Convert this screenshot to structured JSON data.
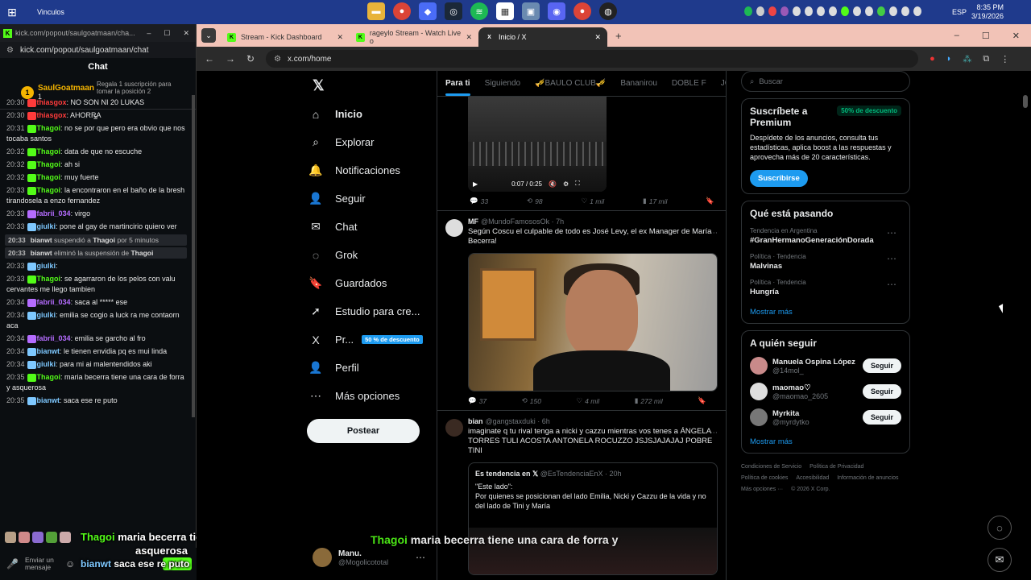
{
  "taskbar": {
    "title": "Vinculos",
    "lang": "ESP",
    "time": "8:35 PM",
    "date": "3/19/2026"
  },
  "popout": {
    "tab_title": "kick.com/popout/saulgoatmaan/cha...",
    "url": "kick.com/popout/saulgoatmaan/chat",
    "header": "Chat",
    "pinned_user": "SaulGoatmaan",
    "pinned_count": "1",
    "pinned_gift": "Regala 1 suscripción para tomar la posición 2",
    "input_placeholder": "Enviar un mensaje",
    "chat_button": "Chat"
  },
  "messages": [
    {
      "time": "20:30",
      "user": "thiasgox",
      "color": "#ff3b3b",
      "text": ": NO SON NI 20 LUKAS"
    },
    {
      "time": "20:30",
      "user": "thiasgox",
      "color": "#ff3b3b",
      "text": ": AHORRA"
    },
    {
      "time": "20:31",
      "user": "Thagoi",
      "color": "#53fc18",
      "text": ": no se por que pero era obvio que nos tocaba santos"
    },
    {
      "time": "20:32",
      "user": "Thagoi",
      "color": "#53fc18",
      "text": ": data de que no escuche"
    },
    {
      "time": "20:32",
      "user": "Thagoi",
      "color": "#53fc18",
      "text": ": ah si"
    },
    {
      "time": "20:32",
      "user": "Thagoi",
      "color": "#53fc18",
      "text": ": muy fuerte"
    },
    {
      "time": "20:33",
      "user": "Thagoi",
      "color": "#53fc18",
      "text": ": la encontraron en el baño de la bresh tirandosela a enzo fernandez"
    },
    {
      "time": "20:33",
      "user": "fabrii_034",
      "color": "#b56cff",
      "text": ": virgo"
    },
    {
      "time": "20:33",
      "user": "giulki",
      "color": "#7ec8ff",
      "text": ": pone al gay de martincirio quiero ver"
    }
  ],
  "system": [
    {
      "time": "20:33",
      "a": "bianwt",
      "mid": " suspendió a ",
      "b": "Thagoi",
      "end": " por 5 minutos"
    },
    {
      "time": "20:33",
      "a": "bianwt",
      "mid": " eliminó la suspensión de ",
      "b": "Thagoi",
      "end": ""
    }
  ],
  "messages2": [
    {
      "time": "20:33",
      "user": "giulki",
      "color": "#7ec8ff",
      "text": ":"
    },
    {
      "time": "20:33",
      "user": "Thagoi",
      "color": "#53fc18",
      "text": ": se agarraron de los pelos con valu cervantes me llego tambien"
    },
    {
      "time": "20:34",
      "user": "fabrii_034",
      "color": "#b56cff",
      "text": ": saca al ***** ese"
    },
    {
      "time": "20:34",
      "user": "giulki",
      "color": "#7ec8ff",
      "text": ": emilia se cogio a luck ra me contaorn aca"
    },
    {
      "time": "20:34",
      "user": "fabrii_034",
      "color": "#b56cff",
      "text": ": emilia se garcho al fro"
    },
    {
      "time": "20:34",
      "user": "bianwt",
      "color": "#7ec8ff",
      "text": ": le tienen envidia pq es mui linda"
    },
    {
      "time": "20:34",
      "user": "giulki",
      "color": "#7ec8ff",
      "text": ": para mi ai malentendidos aki"
    },
    {
      "time": "20:35",
      "user": "Thagoi",
      "color": "#53fc18",
      "text": ": maria becerra tiene una cara de forra y asquerosa"
    },
    {
      "time": "20:35",
      "user": "bianwt",
      "color": "#7ec8ff",
      "text": ": saca ese re puto"
    }
  ],
  "overlay": {
    "user1": "Thagoi",
    "line1": " maria becerra tiene una cara de forra y",
    "line1b": "asquerosa",
    "user2": "bianwt",
    "line2": " saca ese re puto"
  },
  "tabs": [
    {
      "label": "Stream - Kick Dashboard",
      "fav": "K",
      "color": "#53fc18"
    },
    {
      "label": "rageylo Stream - Watch Live o",
      "fav": "K",
      "color": "#53fc18"
    },
    {
      "label": "Inicio / X",
      "fav": "X",
      "color": "#fff"
    }
  ],
  "address": "x.com/home",
  "nav": [
    {
      "icon": "⌂",
      "label": "Inicio",
      "name": "home"
    },
    {
      "icon": "⌕",
      "label": "Explorar",
      "name": "explore"
    },
    {
      "icon": "🔔",
      "label": "Notificaciones",
      "name": "notifications"
    },
    {
      "icon": "👤",
      "label": "Seguir",
      "name": "follow"
    },
    {
      "icon": "✉",
      "label": "Chat",
      "name": "chat"
    },
    {
      "icon": "◌",
      "label": "Grok",
      "name": "grok"
    },
    {
      "icon": "🔖",
      "label": "Guardados",
      "name": "bookmarks"
    },
    {
      "icon": "➚",
      "label": "Estudio para cre...",
      "name": "studio"
    },
    {
      "icon": "X",
      "label": "Pr...",
      "name": "premium"
    },
    {
      "icon": "👤",
      "label": "Perfil",
      "name": "profile"
    },
    {
      "icon": "⋯",
      "label": "Más opciones",
      "name": "more"
    }
  ],
  "premium_badge": "50 % de descuento",
  "post_button": "Postear",
  "me": {
    "name": "Manu.",
    "handle": "@Mogolicototal"
  },
  "feed_tabs": [
    "Para ti",
    "Siguiendo",
    "🎺BAULO CLUB🎺",
    "Bananirou",
    "DOBLE F",
    "JOSE"
  ],
  "video": {
    "time": "0:07 / 0:25"
  },
  "post0_actions": {
    "replies": "33",
    "reposts": "98",
    "likes": "1 mil",
    "views": "17 mil"
  },
  "post1": {
    "name": "MF",
    "handle": "@MundoFamososOk · 7h",
    "text": "Según Coscu el culpable de todo es José Levy, el ex Manager de María Becerra!",
    "replies": "37",
    "reposts": "150",
    "likes": "4 mil",
    "views": "272 mil"
  },
  "post2": {
    "name": "bian",
    "handle": "@gangstaxduki · 6h",
    "text": "imaginate q tu rival tenga a nicki y cazzu mientras vos tenes a ÁNGELA TORRES TULI ACOSTA ANTONELA ROCUZZO JSJSJAJAJAJ POBRE TINI",
    "quote_name": "Es tendencia en 𝕏",
    "quote_handle": "@EsTendenciaEnX · 20h",
    "quote_text1": "\"Este lado\":",
    "quote_text2": "Por quienes se posicionan del lado Emilia, Nicki y Cazzu de la vida y no del lado de Tini y María"
  },
  "search_placeholder": "Buscar",
  "premium": {
    "title": "Suscríbete a Premium",
    "badge": "50% de descuento",
    "text": "Despídete de los anuncios, consulta tus estadísticas, aplica boost a las respuestas y aprovecha más de 20 características.",
    "button": "Suscribirse"
  },
  "trends_title": "Qué está pasando",
  "trends": [
    {
      "cat": "Tendencia en Argentina",
      "name": "#GranHermanoGeneraciónDorada"
    },
    {
      "cat": "Política · Tendencia",
      "name": "Malvinas"
    },
    {
      "cat": "Política · Tendencia",
      "name": "Hungría"
    }
  ],
  "show_more": "Mostrar más",
  "follow_title": "A quién seguir",
  "follow": [
    {
      "name": "Manuela Ospina López",
      "handle": "@14mol_",
      "color": "#c98a8a"
    },
    {
      "name": "maomao♡",
      "handle": "@maomao_2605",
      "color": "#ddd"
    },
    {
      "name": "Myrkita",
      "handle": "@myrdytko",
      "color": "#777"
    }
  ],
  "follow_button": "Seguir",
  "footer": [
    "Condiciones de Servicio",
    "Política de Privacidad",
    "Política de cookies",
    "Accesibilidad",
    "Información de anuncios",
    "Más opciones ···",
    "© 2026 X Corp."
  ]
}
